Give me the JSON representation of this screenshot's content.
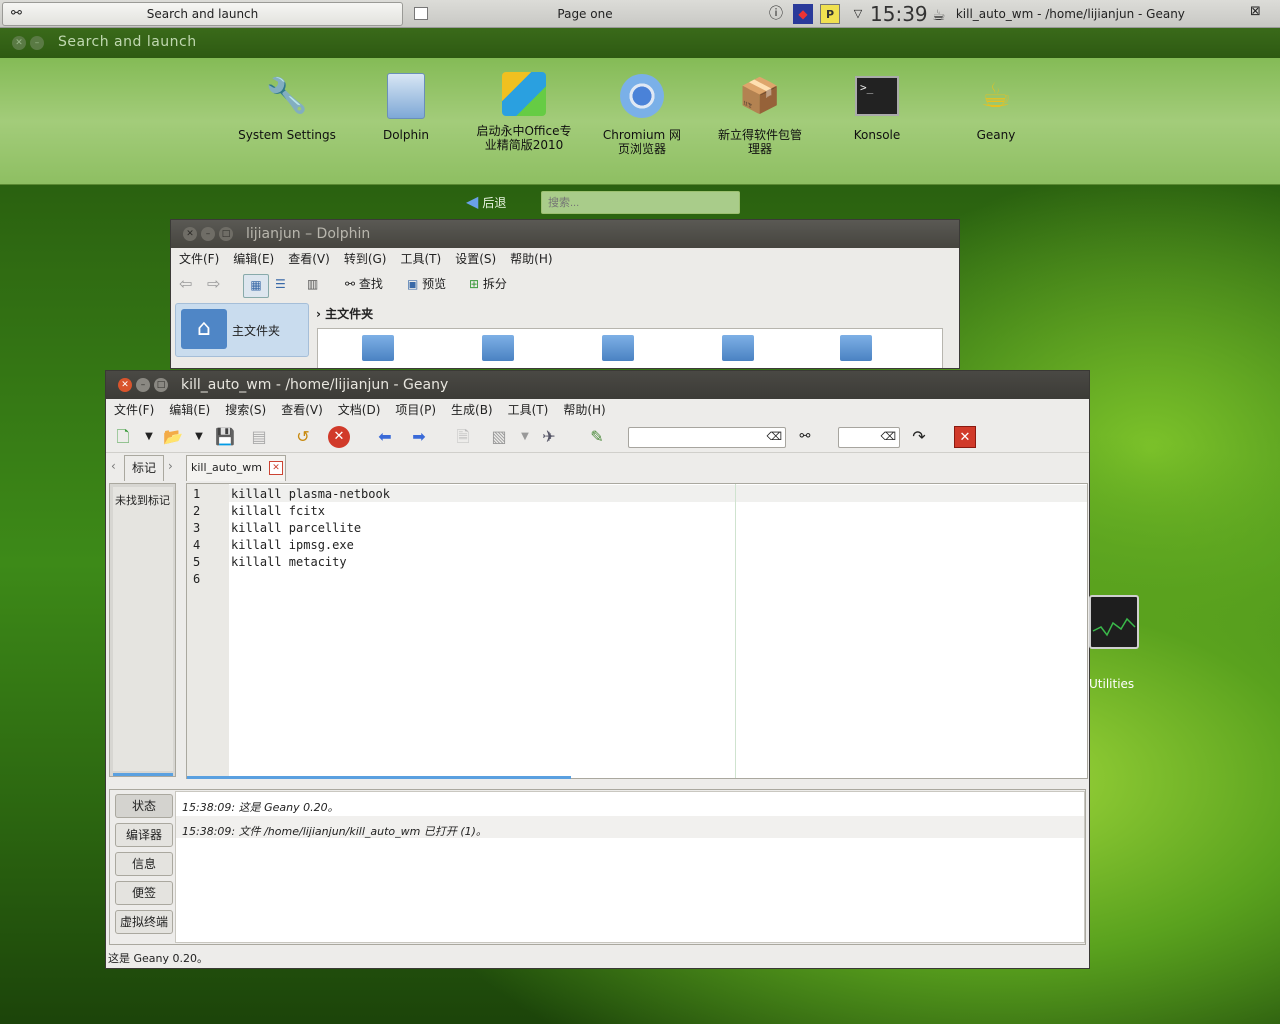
{
  "top_panel": {
    "task_button_label": "Search and launch",
    "page_label": "Page one",
    "clock": "15:39",
    "active_window": "kill_auto_wm - /home/lijianjun - Geany"
  },
  "launcher": {
    "title": "Search and launch",
    "apps": [
      {
        "label": "System Settings",
        "icon": "settings-icon"
      },
      {
        "label": "Dolphin",
        "icon": "file-manager-icon"
      },
      {
        "label": "启动永中Office专业精简版2010",
        "icon": "office-icon"
      },
      {
        "label": "Chromium 网页浏览器",
        "icon": "chromium-icon"
      },
      {
        "label": "新立得软件包管理器",
        "icon": "package-manager-icon"
      },
      {
        "label": "Konsole",
        "icon": "terminal-icon"
      },
      {
        "label": "Geany",
        "icon": "geany-teapot-icon"
      }
    ],
    "back_label": "后退",
    "search_placeholder": "搜索..."
  },
  "dolphin": {
    "title": "lijianjun – Dolphin",
    "menu": [
      "文件(F)",
      "编辑(E)",
      "查看(V)",
      "转到(G)",
      "工具(T)",
      "设置(S)",
      "帮助(H)"
    ],
    "toolbar": {
      "find": "查找",
      "preview": "预览",
      "split": "拆分"
    },
    "places_home": "主文件夹",
    "breadcrumb": "主文件夹"
  },
  "geany": {
    "title": "kill_auto_wm - /home/lijianjun - Geany",
    "menu": [
      "文件(F)",
      "编辑(E)",
      "搜索(S)",
      "查看(V)",
      "文档(D)",
      "项目(P)",
      "生成(B)",
      "工具(T)",
      "帮助(H)"
    ],
    "sidebar_tab": "标记",
    "sidebar_empty": "未找到标记",
    "doc_tab": "kill_auto_wm",
    "lines": [
      "killall plasma-netbook",
      "killall fcitx",
      "killall parcellite",
      "killall ipmsg.exe",
      "killall metacity",
      ""
    ],
    "line_numbers": [
      "1",
      "2",
      "3",
      "4",
      "5",
      "6"
    ],
    "msg_tabs": [
      "状态",
      "编译器",
      "信息",
      "便签",
      "虚拟终端"
    ],
    "messages": [
      "15:38:09: 这是 Geany 0.20。",
      "15:38:09: 文件 /home/lijianjun/kill_auto_wm 已打开 (1)。"
    ],
    "statusbar": "这是 Geany 0.20。"
  },
  "desktop": {
    "utilities_label": "Utilities"
  },
  "colors": {
    "accent_blue": "#4a82c2",
    "close_red": "#d13a2a",
    "launcher_green": "#8ebf62"
  }
}
